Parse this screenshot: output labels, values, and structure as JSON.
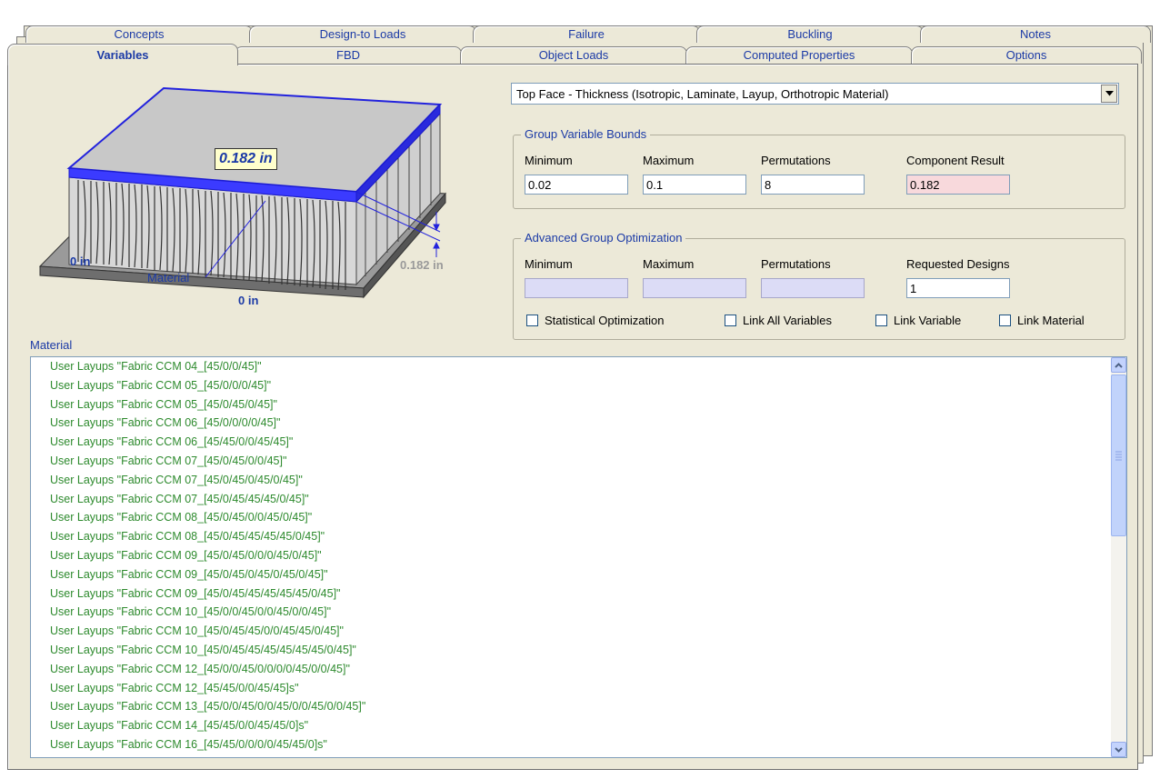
{
  "tabs_row1": [
    "Concepts",
    "Design-to Loads",
    "Failure",
    "Buckling",
    "Notes"
  ],
  "tabs_row2": [
    "Variables",
    "FBD",
    "Object Loads",
    "Computed Properties",
    "Options"
  ],
  "active_tab": "Variables",
  "variable_select": {
    "value": "Top Face - Thickness (Isotropic, Laminate, Layup, Orthotropic Material)"
  },
  "diagram": {
    "thickness_callout": "0.182 in",
    "left_dim": "0 in",
    "bottom_dim": "0 in",
    "right_dim": "0.182 in",
    "material_label": "Material"
  },
  "group_bounds": {
    "title": "Group Variable Bounds",
    "minimum_label": "Minimum",
    "maximum_label": "Maximum",
    "permutations_label": "Permutations",
    "result_label": "Component Result",
    "minimum": "0.02",
    "maximum": "0.1",
    "permutations": "8",
    "result": "0.182"
  },
  "advanced": {
    "title": "Advanced Group Optimization",
    "minimum_label": "Minimum",
    "maximum_label": "Maximum",
    "permutations_label": "Permutations",
    "requested_label": "Requested Designs",
    "minimum": "",
    "maximum": "",
    "permutations": "",
    "requested": "1",
    "stat_opt_label": "Statistical Optimization",
    "link_all_label": "Link All Variables",
    "link_var_label": "Link Variable",
    "link_mat_label": "Link Material"
  },
  "material_list": {
    "label": "Material",
    "items": [
      "User Layups \"Fabric CCM 04_[45/0/0/45]\"",
      "User Layups \"Fabric CCM 05_[45/0/0/0/45]\"",
      "User Layups \"Fabric CCM 05_[45/0/45/0/45]\"",
      "User Layups \"Fabric CCM 06_[45/0/0/0/0/45]\"",
      "User Layups \"Fabric CCM 06_[45/45/0/0/45/45]\"",
      "User Layups \"Fabric CCM 07_[45/0/45/0/0/45]\"",
      "User Layups \"Fabric CCM 07_[45/0/45/0/45/0/45]\"",
      "User Layups \"Fabric CCM 07_[45/0/45/45/45/0/45]\"",
      "User Layups \"Fabric CCM 08_[45/0/45/0/0/45/0/45]\"",
      "User Layups \"Fabric CCM 08_[45/0/45/45/45/45/0/45]\"",
      "User Layups \"Fabric CCM 09_[45/0/45/0/0/0/45/0/45]\"",
      "User Layups \"Fabric CCM 09_[45/0/45/0/45/0/45/0/45]\"",
      "User Layups \"Fabric CCM 09_[45/0/45/45/45/45/45/0/45]\"",
      "User Layups \"Fabric CCM 10_[45/0/0/45/0/0/45/0/0/45]\"",
      "User Layups \"Fabric CCM 10_[45/0/45/45/0/0/45/45/0/45]\"",
      "User Layups \"Fabric CCM 10_[45/0/45/45/45/45/45/45/0/45]\"",
      "User Layups \"Fabric CCM 12_[45/0/0/45/0/0/0/0/45/0/0/45]\"",
      "User Layups \"Fabric CCM 12_[45/45/0/0/45/45]s\"",
      "User Layups \"Fabric CCM 13_[45/0/0/45/0/0/45/0/0/45/0/0/45]\"",
      "User Layups \"Fabric CCM 14_[45/45/0/0/45/45/0]s\"",
      "User Layups \"Fabric CCM 16_[45/45/0/0/0/0/45/45/0]s\""
    ]
  },
  "colors": {
    "tab_text": "#1b3aa6",
    "list_text": "#2d8a2d",
    "panel_bg": "#ece9d8",
    "result_bg": "#f8d9dc",
    "disabled_bg": "#dcdcf6"
  }
}
